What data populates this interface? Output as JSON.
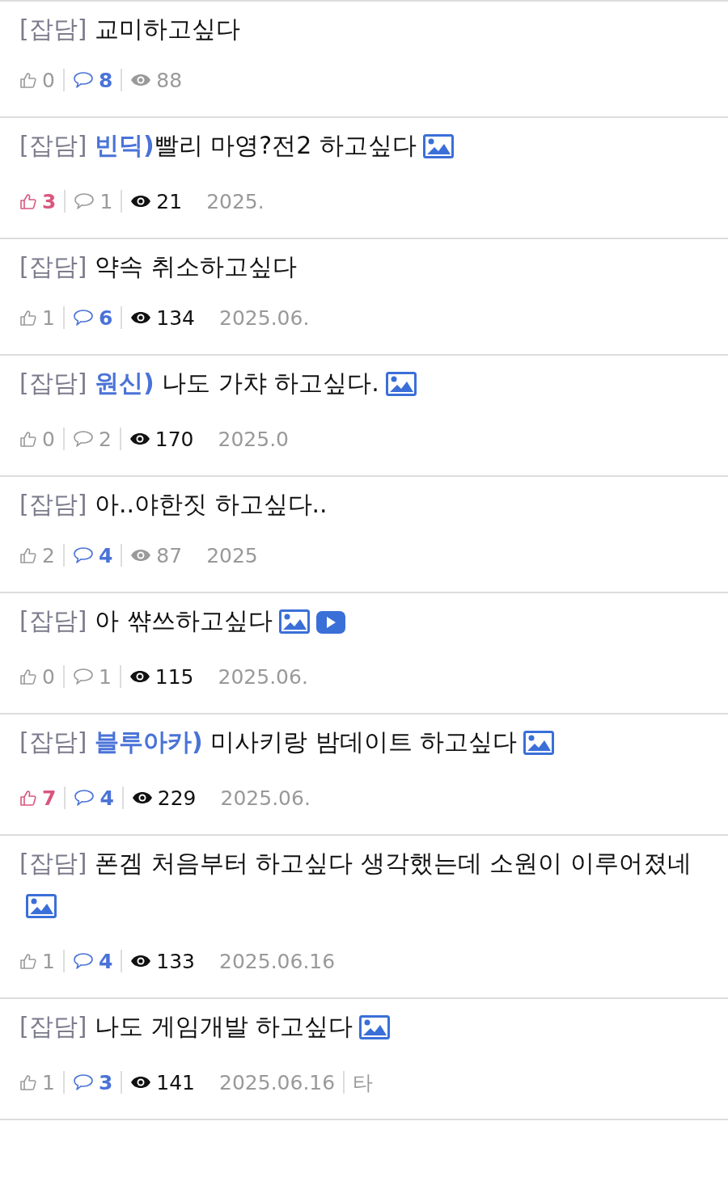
{
  "posts": [
    {
      "category": "[잡담]",
      "title": "교미하고싶다",
      "likes": {
        "count": "0",
        "highlighted": false
      },
      "comments": {
        "count": "8",
        "highlighted": true
      },
      "views": {
        "count": "88",
        "highlighted": false
      }
    },
    {
      "category": "[잡담]",
      "game": "빈딕)",
      "title": "빨리 마영?전2 하고싶다",
      "attachments": [
        {
          "kind": "image"
        }
      ],
      "likes": {
        "count": "3",
        "highlighted": true
      },
      "comments": {
        "count": "1",
        "highlighted": false
      },
      "views": {
        "count": "21",
        "highlighted": true
      },
      "date": "2025."
    },
    {
      "category": "[잡담]",
      "title": "약속 취소하고싶다",
      "likes": {
        "count": "1",
        "highlighted": false
      },
      "comments": {
        "count": "6",
        "highlighted": true
      },
      "views": {
        "count": "134",
        "highlighted": true
      },
      "date": "2025.06."
    },
    {
      "category": "[잡담]",
      "game": "원신)",
      "title": " 나도 가챠 하고싶다.",
      "attachments": [
        {
          "kind": "image"
        }
      ],
      "likes": {
        "count": "0",
        "highlighted": false
      },
      "comments": {
        "count": "2",
        "highlighted": false
      },
      "views": {
        "count": "170",
        "highlighted": true
      },
      "date": "2025.0"
    },
    {
      "category": "[잡담]",
      "title": "아..야한짓 하고싶다..",
      "likes": {
        "count": "2",
        "highlighted": false
      },
      "comments": {
        "count": "4",
        "highlighted": true
      },
      "views": {
        "count": "87",
        "highlighted": false
      },
      "date": "2025"
    },
    {
      "category": "[잡담]",
      "title": "아 쌲쓰하고싶다",
      "attachments": [
        {
          "kind": "image"
        },
        {
          "kind": "video"
        }
      ],
      "likes": {
        "count": "0",
        "highlighted": false
      },
      "comments": {
        "count": "1",
        "highlighted": false
      },
      "views": {
        "count": "115",
        "highlighted": true
      },
      "date": "2025.06."
    },
    {
      "category": "[잡담]",
      "game": "블루아카)",
      "title": " 미사키랑 밤데이트 하고싶다",
      "attachments": [
        {
          "kind": "image"
        }
      ],
      "likes": {
        "count": "7",
        "highlighted": true
      },
      "comments": {
        "count": "4",
        "highlighted": true
      },
      "views": {
        "count": "229",
        "highlighted": true
      },
      "date": "2025.06."
    },
    {
      "category": "[잡담]",
      "title": "폰겜 처음부터 하고싶다 생각했는데 소원이 이루어졌네",
      "attachments": [
        {
          "kind": "image"
        }
      ],
      "likes": {
        "count": "1",
        "highlighted": false
      },
      "comments": {
        "count": "4",
        "highlighted": true
      },
      "views": {
        "count": "133",
        "highlighted": true
      },
      "date": "2025.06.16"
    },
    {
      "category": "[잡담]",
      "title": "나도 게임개발 하고싶다",
      "attachments": [
        {
          "kind": "image"
        }
      ],
      "likes": {
        "count": "1",
        "highlighted": false
      },
      "comments": {
        "count": "3",
        "highlighted": true
      },
      "views": {
        "count": "141",
        "highlighted": true
      },
      "date": "2025.06.16",
      "author": "타"
    }
  ]
}
